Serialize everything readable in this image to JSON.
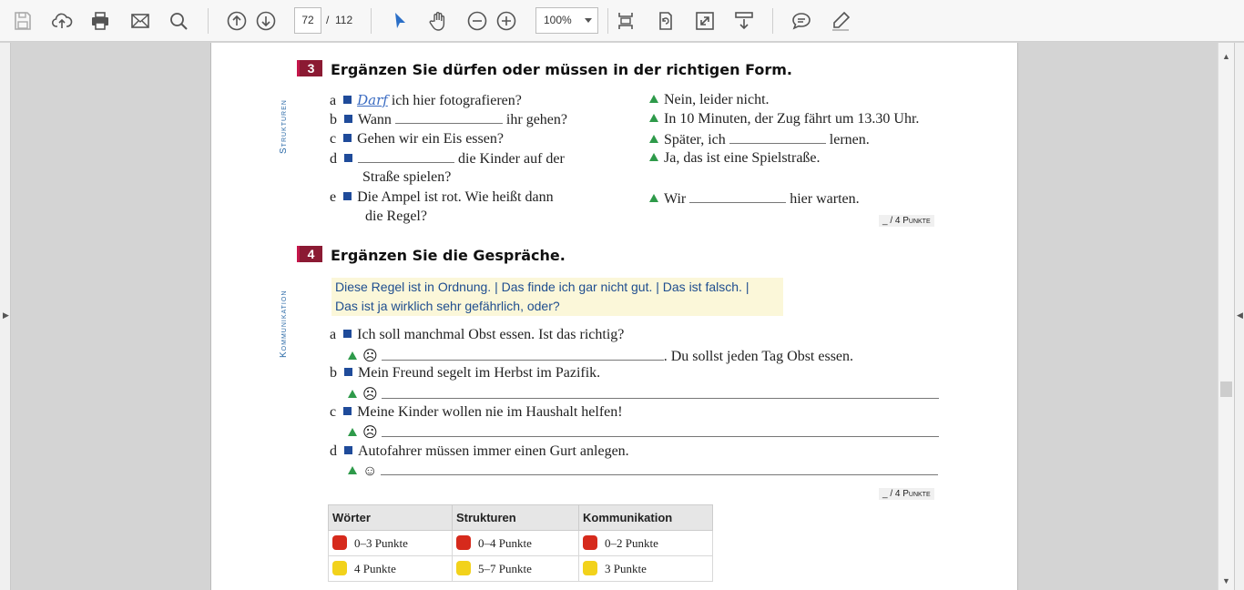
{
  "toolbar": {
    "current_page": "72",
    "page_separator": "/",
    "total_pages": "112",
    "zoom": "100%"
  },
  "document": {
    "ex3": {
      "number": "3",
      "title": "Ergänzen Sie dürfen oder müssen in der richtigen Form.",
      "side_label": "Strukturen",
      "items": [
        {
          "letter": "a",
          "q_fill": "Darf",
          "q": "ich hier fotografieren?",
          "a": "Nein, leider nicht."
        },
        {
          "letter": "b",
          "q_pre": "Wann",
          "q_post": "ihr gehen?",
          "a": "In 10 Minuten, der Zug fährt um 13.30 Uhr."
        },
        {
          "letter": "c",
          "q": "Gehen wir ein Eis essen?",
          "a_pre": "Später, ich",
          "a_post": "lernen."
        },
        {
          "letter": "d",
          "q_post": "die Kinder auf der",
          "q_cont": "Straße spielen?",
          "a": "Ja, das ist eine Spielstraße."
        },
        {
          "letter": "e",
          "q": "Die Ampel ist rot. Wie heißt dann",
          "q_cont": "die Regel?",
          "a_pre": "Wir",
          "a_post": "hier warten."
        }
      ],
      "points": "_ / 4 Punkte"
    },
    "ex4": {
      "number": "4",
      "title": "Ergänzen Sie die Gespräche.",
      "side_label": "Kommunikation",
      "word_box_line1": "Diese Regel ist in Ordnung. | Das finde ich gar nicht gut. | Das ist falsch. |",
      "word_box_line2": "Das ist ja wirklich sehr gefährlich, oder?",
      "items": [
        {
          "letter": "a",
          "q": "Ich soll manchmal Obst essen. Ist das richtig?",
          "face": "☹",
          "a_post": ". Du sollst jeden Tag Obst essen."
        },
        {
          "letter": "b",
          "q": "Mein Freund segelt im Herbst im Pazifik.",
          "face": "☹"
        },
        {
          "letter": "c",
          "q": "Meine Kinder wollen nie im Haushalt helfen!",
          "face": "☹"
        },
        {
          "letter": "d",
          "q": "Autofahrer müssen immer einen Gurt anlegen.",
          "face": "☺"
        }
      ],
      "points": "_ / 4 Punkte"
    },
    "results": {
      "headers": [
        "Wörter",
        "Strukturen",
        "Kommunikation"
      ],
      "rows": [
        {
          "color": "#d62a1c",
          "cells": [
            "0–3 Punkte",
            "0–4 Punkte",
            "0–2 Punkte"
          ]
        },
        {
          "color": "#f2d21b",
          "cells": [
            "4 Punkte",
            "5–7 Punkte",
            "3 Punkte"
          ]
        }
      ]
    }
  }
}
